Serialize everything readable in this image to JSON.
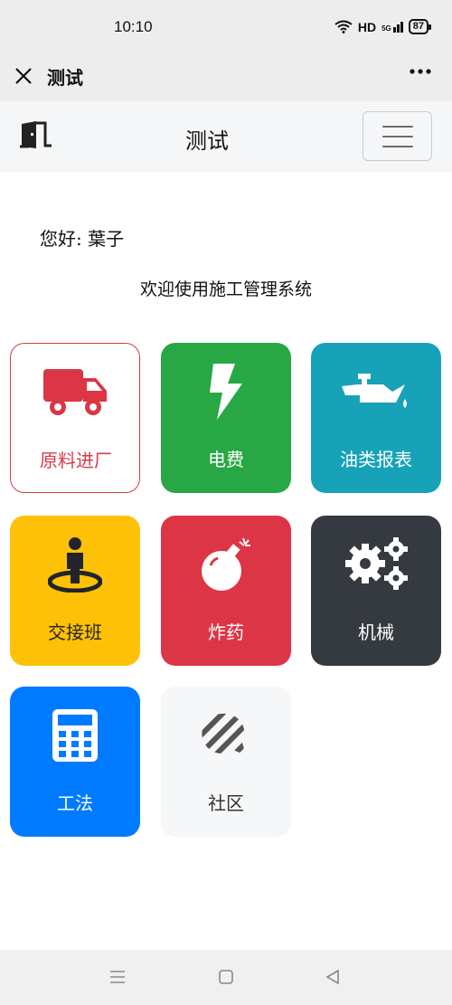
{
  "status_bar": {
    "time": "10:10",
    "network": "HD",
    "signal": "5G",
    "battery": "87"
  },
  "top_bar": {
    "title": "测试"
  },
  "navbar": {
    "title": "测试"
  },
  "greeting": {
    "prefix": "您好:",
    "name": "葉子"
  },
  "welcome": "欢迎使用施工管理系统",
  "tiles": [
    {
      "label": "原料进厂",
      "icon": "truck-icon",
      "color": "#dc3545"
    },
    {
      "label": "电费",
      "icon": "bolt-icon",
      "color": "#28a745"
    },
    {
      "label": "油类报表",
      "icon": "oil-can-icon",
      "color": "#17a2b8"
    },
    {
      "label": "交接班",
      "icon": "person-pin-icon",
      "color": "#ffc107"
    },
    {
      "label": "炸药",
      "icon": "bomb-icon",
      "color": "#dc3545"
    },
    {
      "label": "机械",
      "icon": "gears-icon",
      "color": "#343a40"
    },
    {
      "label": "工法",
      "icon": "calculator-icon",
      "color": "#007bff"
    },
    {
      "label": "社区",
      "icon": "chat-bubble-icon",
      "color": "#f5f7f9"
    }
  ]
}
